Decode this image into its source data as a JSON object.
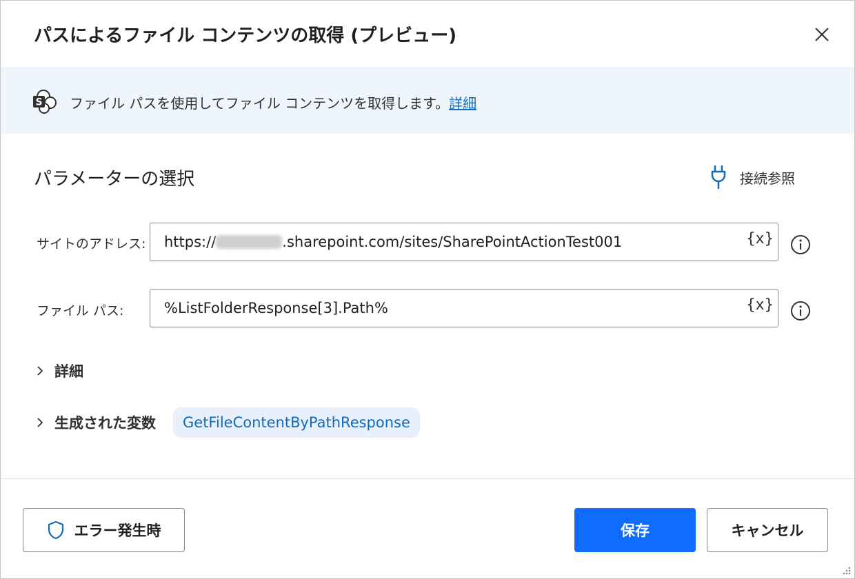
{
  "dialog": {
    "title": "パスによるファイル コンテンツの取得 (プレビュー)",
    "close_icon": "close-icon"
  },
  "banner": {
    "icon": "sharepoint-icon",
    "text": "ファイル パスを使用してファイル コンテンツを取得します。",
    "link": "詳細"
  },
  "parameters": {
    "section_title": "パラメーターの選択",
    "connection_icon": "plug-icon",
    "connection_label": "接続参照"
  },
  "fields": {
    "site_address": {
      "label": "サイトのアドレス:",
      "value_prefix": "https://",
      "value_suffix": ".sharepoint.com/sites/SharePointActionTest001",
      "var_button": "{x}"
    },
    "file_path": {
      "label": "ファイル パス:",
      "value": "%ListFolderResponse[3].Path%",
      "var_button": "{x}"
    }
  },
  "sections": {
    "details_label": "詳細",
    "generated_vars_label": "生成された変数",
    "generated_var_name": "GetFileContentByPathResponse"
  },
  "footer": {
    "on_error_label": "エラー発生時",
    "save_label": "保存",
    "cancel_label": "キャンセル"
  },
  "colors": {
    "accent": "#0f6cfd",
    "link": "#0f6cbd",
    "banner_bg": "#eff5fc"
  }
}
